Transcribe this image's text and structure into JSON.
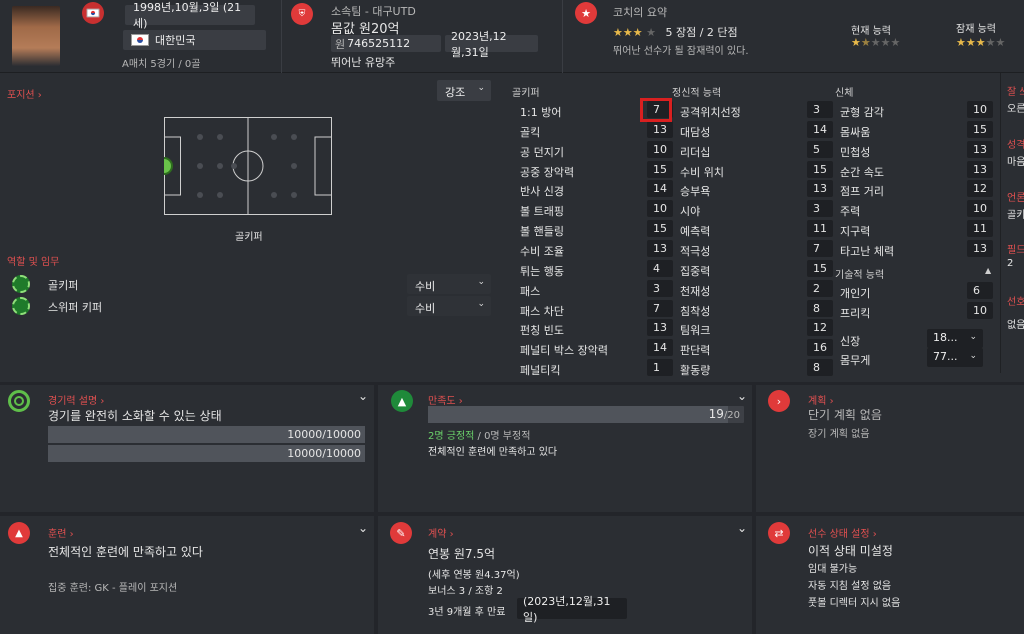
{
  "header": {
    "dob": "1998년,10월,3일 (21세)",
    "nation": "대한민국",
    "caps": "A매치 5경기 / 0골",
    "club_label": "소속팀 - 대구UTD",
    "value_label": "몸값 원20억",
    "wage_prefix": "원",
    "wage_value": "746525112",
    "contract_end": "2023년,12월,31일",
    "foot": "뛰어난 유망주",
    "coach_title": "코치의 요약",
    "coach_stars": "5 장점 / 2 단점",
    "coach_note": "뛰어난 선수가 될 잠재력이 있다.",
    "current_ability": "현재 능력",
    "potential_ability": "잠재 능력"
  },
  "position": {
    "title": "포지션",
    "dropdown": "강조",
    "pitch_label": "골키퍼",
    "roles_title": "역할 및 임무",
    "roles": [
      {
        "name": "골키퍼",
        "duty": "수비"
      },
      {
        "name": "스위퍼 키퍼",
        "duty": "수비"
      }
    ]
  },
  "attributes": {
    "gk_header": "골키퍼",
    "mental_header": "정신적 능력",
    "physical_header": "신체",
    "technical_header": "기술적 능력",
    "gk": [
      {
        "name": "1:1 방어",
        "value": "7"
      },
      {
        "name": "골킥",
        "value": "13"
      },
      {
        "name": "공 던지기",
        "value": "10"
      },
      {
        "name": "공중 장악력",
        "value": "15"
      },
      {
        "name": "반사 신경",
        "value": "14"
      },
      {
        "name": "볼 트래핑",
        "value": "10"
      },
      {
        "name": "볼 핸들링",
        "value": "15"
      },
      {
        "name": "수비 조율",
        "value": "13"
      },
      {
        "name": "튀는 행동",
        "value": "4"
      },
      {
        "name": "패스",
        "value": "3"
      },
      {
        "name": "패스 차단",
        "value": "7"
      },
      {
        "name": "펀칭 빈도",
        "value": "13"
      },
      {
        "name": "페널티 박스 장악력",
        "value": "14"
      },
      {
        "name": "페널티킥",
        "value": "1"
      }
    ],
    "mental": [
      {
        "name": "공격위치선정",
        "value": "3"
      },
      {
        "name": "대담성",
        "value": "14"
      },
      {
        "name": "리더십",
        "value": "5"
      },
      {
        "name": "수비 위치",
        "value": "15"
      },
      {
        "name": "승부욕",
        "value": "13"
      },
      {
        "name": "시야",
        "value": "3"
      },
      {
        "name": "예측력",
        "value": "11"
      },
      {
        "name": "적극성",
        "value": "7"
      },
      {
        "name": "집중력",
        "value": "15"
      },
      {
        "name": "천재성",
        "value": "2"
      },
      {
        "name": "침착성",
        "value": "8"
      },
      {
        "name": "팀워크",
        "value": "12"
      },
      {
        "name": "판단력",
        "value": "16"
      },
      {
        "name": "활동량",
        "value": "8"
      }
    ],
    "physical": [
      {
        "name": "균형 감각",
        "value": "10"
      },
      {
        "name": "몸싸움",
        "value": "15"
      },
      {
        "name": "민첩성",
        "value": "13"
      },
      {
        "name": "순간 속도",
        "value": "13"
      },
      {
        "name": "점프 거리",
        "value": "12"
      },
      {
        "name": "주력",
        "value": "10"
      },
      {
        "name": "지구력",
        "value": "11"
      },
      {
        "name": "타고난 체력",
        "value": "13"
      }
    ],
    "technical": [
      {
        "name": "개인기",
        "value": "6"
      },
      {
        "name": "프리킥",
        "value": "10"
      }
    ],
    "height_label": "신장",
    "height_value": "18...",
    "weight_label": "몸무게",
    "weight_value": "77..."
  },
  "rightcut": {
    "a": "잘 쓰",
    "a_v": "오른",
    "b": "성격",
    "b_v": "마음",
    "c": "언론",
    "c_v": "골키",
    "d": "필드",
    "d_v": "2",
    "e": "선호",
    "e_v": "없음"
  },
  "cards": {
    "fitness": {
      "title": "경기력 설명",
      "main": "경기를 완전히 소화할 수 있는 상태",
      "bar1": "10000/10000",
      "bar1_frac": 1.0,
      "bar2": "10000/10000",
      "bar2_frac": 1.0
    },
    "satisfaction": {
      "title": "만족도",
      "score": "19",
      "score_max": "/20",
      "frac": 0.95,
      "positive": "2명 긍정적",
      "negative": " / 0명 부정적",
      "note": "전체적인 훈련에 만족하고 있다"
    },
    "plan": {
      "title": "계획",
      "main": "단기 계획 없음",
      "sub": "장기 계획 없음"
    },
    "training": {
      "title": "훈련",
      "main": "전체적인 훈련에 만족하고 있다",
      "sub": "집중 훈련: GK - 플레이 포지션"
    },
    "contract": {
      "title": "계약",
      "main": "연봉 원7.5억",
      "sub1": "(세후 연봉 원4.37억)",
      "sub2": "보너스 3 / 조항 2",
      "expiry": "3년 9개월 후 만료",
      "date": "(2023년,12월,31일)"
    },
    "status": {
      "title": "선수 상태 설정",
      "main": "이적 상태 미설정",
      "l1": "임대 불가능",
      "l2": "자동 지침 설정 없음",
      "l3": "풋볼 디렉터 지시 없음"
    }
  }
}
